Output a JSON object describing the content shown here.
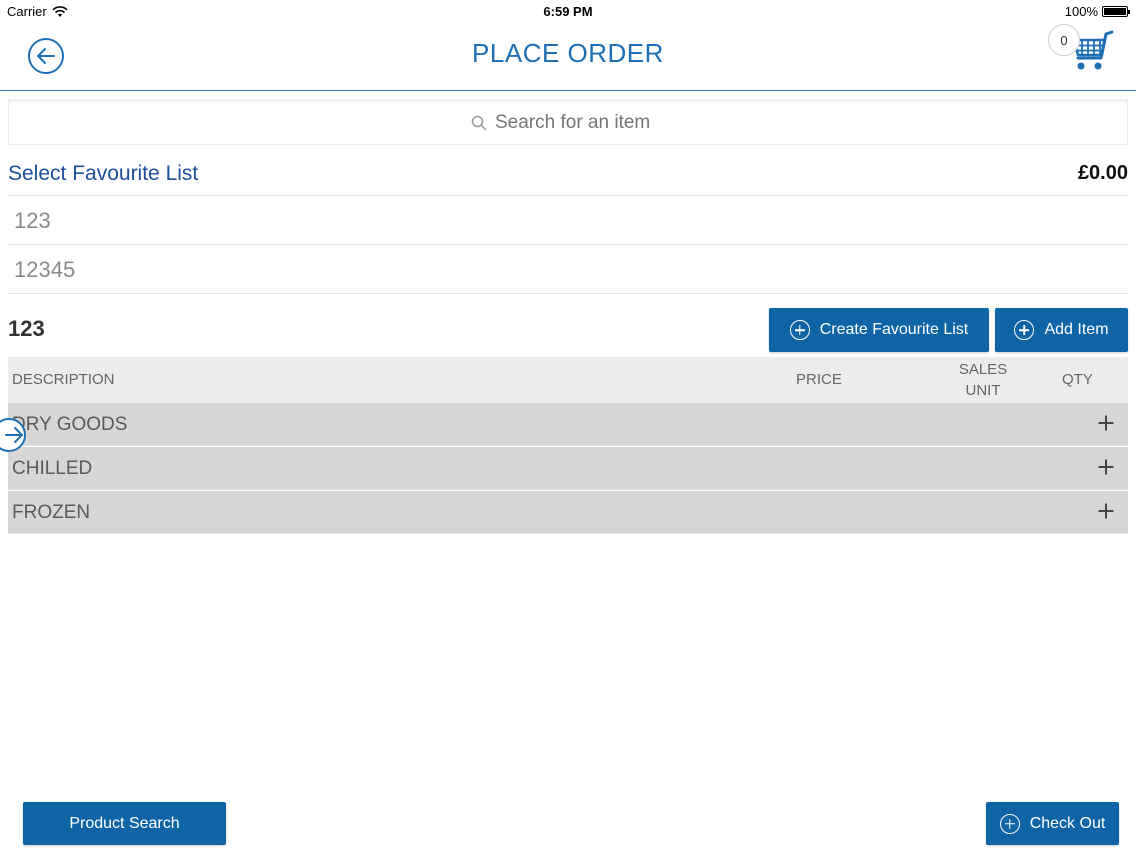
{
  "status_bar": {
    "carrier": "Carrier",
    "time": "6:59 PM",
    "battery": "100%"
  },
  "header": {
    "title": "PLACE ORDER",
    "cart_count": "0",
    "accent_color": "#1f6fb5"
  },
  "search": {
    "placeholder": "Search for an item"
  },
  "favourites": {
    "title": "Select Favourite List",
    "total": "£0.00",
    "lists": [
      "123",
      "12345"
    ]
  },
  "selected_list": {
    "name": "123",
    "create_button": "Create Favourite List",
    "add_item_button": "Add Item"
  },
  "table": {
    "headers": {
      "description": "DESCRIPTION",
      "price": "PRICE",
      "sales_unit": "SALES UNIT",
      "qty": "QTY"
    },
    "categories": [
      "DRY GOODS",
      "CHILLED",
      "FROZEN"
    ]
  },
  "footer": {
    "product_search": "Product Search",
    "check_out": "Check Out"
  },
  "icons": [
    "wifi-icon",
    "battery-icon",
    "back-arrow-icon",
    "cart-icon",
    "search-icon",
    "plus-circle-icon",
    "plus-icon",
    "forward-arrow-icon"
  ]
}
